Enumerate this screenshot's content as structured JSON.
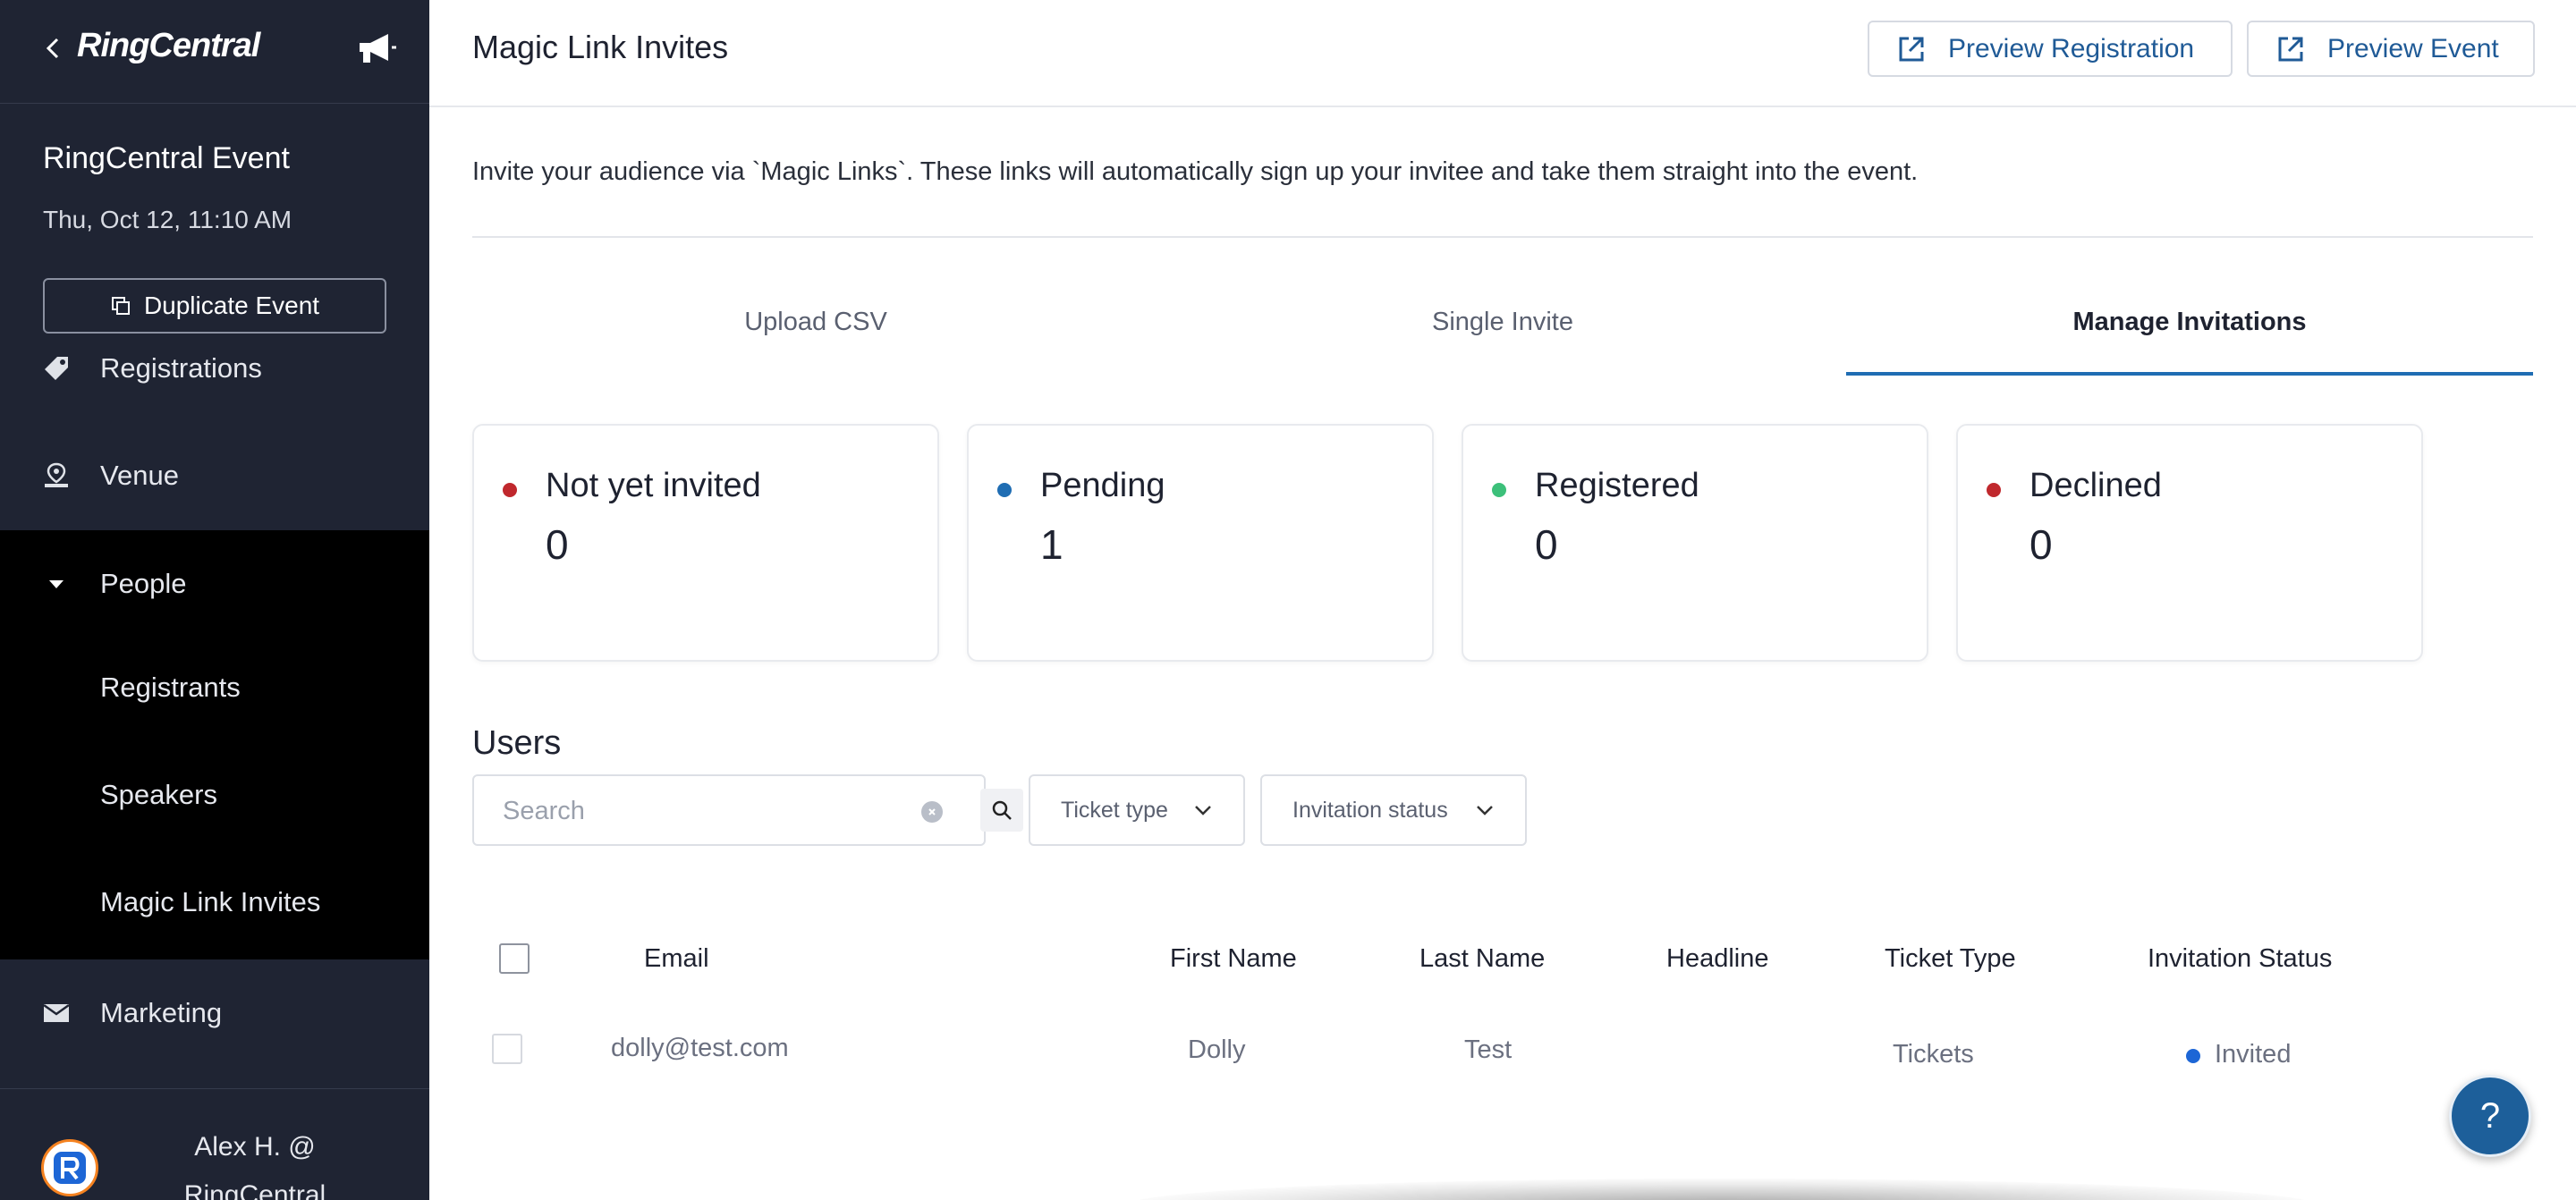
{
  "sidebar": {
    "brand": "RingCentral",
    "event_title": "RingCentral Event",
    "event_date": "Thu, Oct 12, 11:10 AM",
    "duplicate_label": "Duplicate Event",
    "nav": {
      "registrations": "Registrations",
      "venue": "Venue",
      "people": "People",
      "registrants": "Registrants",
      "speakers": "Speakers",
      "magic_link_invites": "Magic Link Invites",
      "marketing": "Marketing"
    },
    "user_line1": "Alex H. @",
    "user_line2": "RingCentral"
  },
  "header": {
    "title": "Magic Link Invites",
    "preview_registration": "Preview Registration",
    "preview_event": "Preview Event"
  },
  "intro_text": "Invite your audience via `Magic Links`. These links will automatically sign up your invitee and take them straight into the event.",
  "tabs": [
    "Upload CSV",
    "Single Invite",
    "Manage Invitations"
  ],
  "active_tab": "Manage Invitations",
  "stats": [
    {
      "label": "Not yet invited",
      "value": "0",
      "color": "#c0282d"
    },
    {
      "label": "Pending",
      "value": "1",
      "color": "#1f6db3"
    },
    {
      "label": "Registered",
      "value": "0",
      "color": "#3cc07a"
    },
    {
      "label": "Declined",
      "value": "0",
      "color": "#c0282d"
    }
  ],
  "users": {
    "heading": "Users",
    "search_placeholder": "Search",
    "filter_ticket": "Ticket type",
    "filter_status": "Invitation status"
  },
  "table": {
    "columns": [
      "Email",
      "First Name",
      "Last Name",
      "Headline",
      "Ticket Type",
      "Invitation Status"
    ],
    "rows": [
      {
        "email": "dolly@test.com",
        "first_name": "Dolly",
        "last_name": "Test",
        "headline": "",
        "ticket_type": "Tickets",
        "status": "Invited",
        "status_color": "#1d66d6"
      }
    ]
  },
  "help_label": "?",
  "colors": {
    "sidebar_bg": "#1f2433",
    "active_nav_bg": "#000000",
    "accent": "#1f6db3"
  }
}
